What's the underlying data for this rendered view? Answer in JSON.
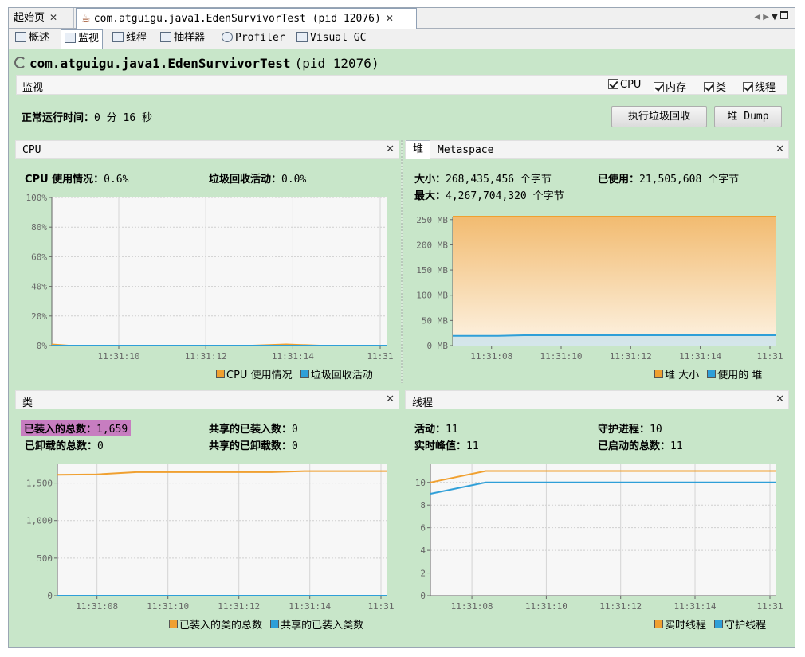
{
  "tabs": {
    "start_label": "起始页",
    "app_label": "com.atguigu.java1.EdenSurvivorTest (pid 12076)"
  },
  "subtabs": [
    "概述",
    "监视",
    "线程",
    "抽样器",
    "Profiler",
    "Visual GC"
  ],
  "app_title": {
    "name": "com.atguigu.java1.EdenSurvivorTest",
    "pid": "(pid 12076)"
  },
  "monitor": {
    "title": "监视",
    "checkboxes": [
      "CPU",
      "内存",
      "类",
      "线程"
    ],
    "uptime_label": "正常运行时间：",
    "uptime_value": "0 分 16 秒",
    "gc_button": "执行垃圾回收",
    "dump_button": "堆 Dump"
  },
  "cpu_panel": {
    "title": "CPU",
    "usage_label": "CPU 使用情况：",
    "usage_value": "0.6%",
    "gc_label": "垃圾回收活动：",
    "gc_value": "0.0%",
    "legend": [
      "CPU 使用情况",
      "垃圾回收活动"
    ]
  },
  "heap_panel": {
    "tab_heap": "堆",
    "tab_meta": "Metaspace",
    "size_label": "大小：",
    "size_value": "268,435,456 个字节",
    "used_label": "已使用：",
    "used_value": "21,505,608 个字节",
    "max_label": "最大：",
    "max_value": "4,267,704,320 个字节",
    "legend": [
      "堆 大小",
      "使用的 堆"
    ]
  },
  "class_panel": {
    "title": "类",
    "loaded_label": "已装入的总数：",
    "loaded_value": "1,659",
    "unloaded_label": "已卸载的总数：",
    "unloaded_value": "0",
    "shared_loaded_label": "共享的已装入数：",
    "shared_loaded_value": "0",
    "shared_unloaded_label": "共享的已卸载数：",
    "shared_unloaded_value": "0",
    "legend": [
      "已装入的类的总数",
      "共享的已装入类数"
    ]
  },
  "thread_panel": {
    "title": "线程",
    "live_label": "活动：",
    "live_value": "11",
    "peak_label": "实时峰值：",
    "peak_value": "11",
    "daemon_label": "守护进程：",
    "daemon_value": "10",
    "started_label": "已启动的总数：",
    "started_value": "11",
    "legend": [
      "实时线程",
      "守护线程"
    ]
  },
  "colors": {
    "orange": "#f0a030",
    "blue": "#2f9fd8",
    "highlight": "#c77dc0"
  },
  "chart_data": [
    {
      "type": "line",
      "title": "CPU",
      "x_ticks": [
        "11:31:10",
        "11:31:12",
        "11:31:14",
        "11:31"
      ],
      "y_ticks": [
        "0%",
        "20%",
        "40%",
        "60%",
        "80%",
        "100%"
      ],
      "ylim": [
        0,
        100
      ],
      "xlim": [
        0,
        1
      ],
      "series": [
        {
          "name": "CPU 使用情况",
          "color": "#f0a030",
          "x": [
            0,
            0.05,
            0.6,
            0.7,
            0.8,
            1
          ],
          "y": [
            0.8,
            0,
            0,
            0.8,
            0,
            0
          ]
        },
        {
          "name": "垃圾回收活动",
          "color": "#2f9fd8",
          "x": [
            0,
            1
          ],
          "y": [
            0,
            0
          ]
        }
      ]
    },
    {
      "type": "area",
      "title": "堆",
      "x_ticks": [
        "11:31:08",
        "11:31:10",
        "11:31:12",
        "11:31:14",
        "11:31"
      ],
      "y_ticks": [
        "0 MB",
        "50 MB",
        "100 MB",
        "150 MB",
        "200 MB",
        "250 MB"
      ],
      "ylim": [
        0,
        256
      ],
      "xlim": [
        0,
        1
      ],
      "series": [
        {
          "name": "堆 大小",
          "color": "#f0a030",
          "x": [
            0,
            1
          ],
          "y": [
            256,
            256
          ]
        },
        {
          "name": "使用的 堆",
          "color": "#2f9fd8",
          "x": [
            0,
            0.14,
            0.22,
            1
          ],
          "y": [
            19.5,
            19.5,
            20.5,
            20.5
          ]
        }
      ]
    },
    {
      "type": "line",
      "title": "类",
      "x_ticks": [
        "11:31:08",
        "11:31:10",
        "11:31:12",
        "11:31:14",
        "11:31"
      ],
      "y_ticks": [
        "0",
        "500",
        "1,000",
        "1,500"
      ],
      "ylim": [
        0,
        1750
      ],
      "xlim": [
        0,
        1
      ],
      "series": [
        {
          "name": "已装入的类的总数",
          "color": "#f0a030",
          "x": [
            0,
            0.12,
            0.24,
            0.65,
            0.75,
            1
          ],
          "y": [
            1610,
            1615,
            1645,
            1645,
            1659,
            1659
          ]
        },
        {
          "name": "共享的已装入类数",
          "color": "#2f9fd8",
          "x": [
            0,
            1
          ],
          "y": [
            0,
            0
          ]
        }
      ]
    },
    {
      "type": "line",
      "title": "线程",
      "x_ticks": [
        "11:31:08",
        "11:31:10",
        "11:31:12",
        "11:31:14",
        "11:31"
      ],
      "y_ticks": [
        "0",
        "2",
        "4",
        "6",
        "8",
        "10"
      ],
      "ylim": [
        0,
        11.6
      ],
      "xlim": [
        0,
        1
      ],
      "series": [
        {
          "name": "实时线程",
          "color": "#f0a030",
          "x": [
            0,
            0.16,
            1
          ],
          "y": [
            10,
            11,
            11
          ]
        },
        {
          "name": "守护线程",
          "color": "#2f9fd8",
          "x": [
            0,
            0.16,
            1
          ],
          "y": [
            9,
            10,
            10
          ]
        }
      ]
    }
  ]
}
